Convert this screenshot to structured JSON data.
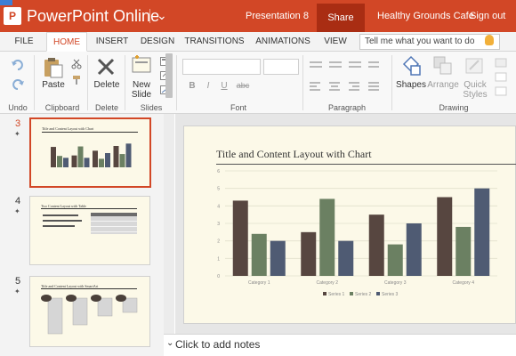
{
  "titlebar": {
    "logo": "P",
    "app_name": "PowerPoint Online",
    "doc_title": "Presentation 8",
    "share": "Share",
    "account": "Healthy Grounds Cafe",
    "signout": "Sign out"
  },
  "tabs": [
    "FILE",
    "HOME",
    "INSERT",
    "DESIGN",
    "TRANSITIONS",
    "ANIMATIONS",
    "VIEW"
  ],
  "active_tab": "HOME",
  "tell_me_placeholder": "Tell me what you want to do",
  "ribbon": {
    "paste": "Paste",
    "delete": "Delete",
    "new_slide_1": "New",
    "new_slide_2": "Slide",
    "shapes": "Shapes",
    "arrange": "Arrange",
    "quick_styles_1": "Quick",
    "quick_styles_2": "Styles",
    "font_controls": [
      "B",
      "I",
      "U",
      "abc"
    ],
    "groups": {
      "undo": "Undo",
      "clipboard": "Clipboard",
      "delete": "Delete",
      "slides": "Slides",
      "font": "Font",
      "paragraph": "Paragraph",
      "drawing": "Drawing"
    }
  },
  "slides": [
    {
      "num": "3",
      "title": "Title and Content Layout with Chart",
      "selected": true
    },
    {
      "num": "4",
      "title": "Two Content Layout with Table",
      "selected": false
    },
    {
      "num": "5",
      "title": "Title and Content Layout with SmartArt",
      "selected": false
    }
  ],
  "current_slide": {
    "title": "Title and Content Layout with Chart"
  },
  "chart_data": {
    "type": "bar",
    "categories": [
      "Category 1",
      "Category 2",
      "Category 3",
      "Category 4"
    ],
    "series": [
      {
        "name": "Series 1",
        "values": [
          4.3,
          2.5,
          3.5,
          4.5
        ],
        "color": "#574640"
      },
      {
        "name": "Series 2",
        "values": [
          2.4,
          4.4,
          1.8,
          2.8
        ],
        "color": "#6b8062"
      },
      {
        "name": "Series 3",
        "values": [
          2.0,
          2.0,
          3.0,
          5.0
        ],
        "color": "#4f5b73"
      }
    ],
    "ylim": [
      0,
      6
    ],
    "yticks": [
      "0",
      "1",
      "2",
      "3",
      "4",
      "5",
      "6"
    ],
    "grid": true,
    "legend": "bottom"
  },
  "notes_placeholder": "Click to add notes"
}
